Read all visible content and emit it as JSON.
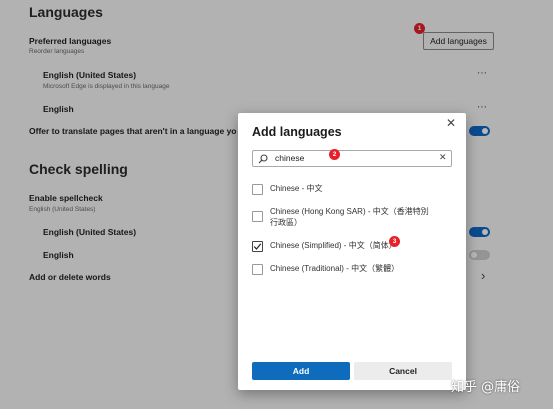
{
  "settings": {
    "languages_heading": "Languages",
    "preferred_label": "Preferred languages",
    "reorder_label": "Reorder languages",
    "add_languages_button": "Add languages",
    "languages": [
      {
        "name": "English (United States)",
        "note": "Microsoft Edge is displayed in this language"
      },
      {
        "name": "English",
        "note": ""
      }
    ],
    "more_icon": "⋯",
    "offer_translate_label": "Offer to translate pages that aren't in a language yo",
    "offer_translate_on": true,
    "spell_heading": "Check spelling",
    "enable_spellcheck_label": "Enable spellcheck",
    "enable_spellcheck_sub": "English (United States)",
    "spell_languages": [
      {
        "name": "English (United States)",
        "on": true
      },
      {
        "name": "English",
        "on": false
      }
    ],
    "add_delete_words_label": "Add or delete words",
    "chevron_icon": "›"
  },
  "dialog": {
    "title": "Add languages",
    "close_icon": "✕",
    "search_value": "chinese",
    "search_icon": "⌕",
    "clear_icon": "✕",
    "options": [
      {
        "label": "Chinese - 中文",
        "checked": false
      },
      {
        "label": "Chinese (Hong Kong SAR) - 中文（香港特別行政區）",
        "checked": false
      },
      {
        "label": "Chinese (Simplified) - 中文（简体）",
        "checked": true
      },
      {
        "label": "Chinese (Traditional) - 中文（繁體）",
        "checked": false
      }
    ],
    "add_button": "Add",
    "cancel_button": "Cancel"
  },
  "badges": [
    "1",
    "2",
    "3"
  ],
  "watermark": "知乎 @庸俗",
  "colors": {
    "accent": "#0f6cbd",
    "badge": "#e8202a",
    "toggle_on": "#0f68c8"
  }
}
